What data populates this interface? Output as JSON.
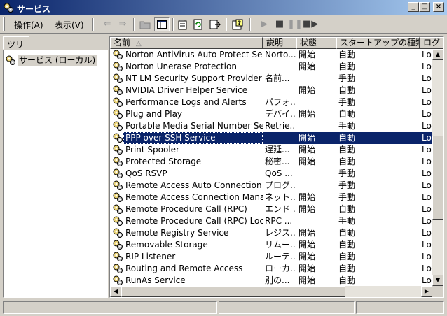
{
  "window": {
    "title": "サービス"
  },
  "menu": {
    "action": "操作(A)",
    "view": "表示(V)"
  },
  "toolbar": {
    "icons": [
      "back-arrow-icon",
      "forward-arrow-icon",
      "folder-up-icon",
      "show-hide-tree-icon",
      "properties-icon",
      "refresh-icon",
      "export-list-icon",
      "help-icon",
      "start-service-icon",
      "stop-service-icon",
      "pause-service-icon",
      "restart-service-icon"
    ]
  },
  "tree": {
    "tab_label": "ツリー",
    "root_label": "サービス (ローカル)"
  },
  "list": {
    "columns": {
      "name": "名前",
      "description": "説明",
      "state": "状態",
      "startup": "スタートアップの種類",
      "logon": "ログ"
    },
    "sort_arrow": "△",
    "rows": [
      {
        "name": "Norton AntiVirus Auto Protect Servi...",
        "description": "Norto...",
        "state": "開始",
        "startup": "自動",
        "logon": "Loc"
      },
      {
        "name": "Norton Unerase Protection",
        "description": "",
        "state": "開始",
        "startup": "自動",
        "logon": "Loc"
      },
      {
        "name": "NT LM Security Support Provider",
        "description": "名前...",
        "state": "",
        "startup": "手動",
        "logon": "Loc"
      },
      {
        "name": "NVIDIA Driver Helper Service",
        "description": "",
        "state": "開始",
        "startup": "自動",
        "logon": "Loc"
      },
      {
        "name": "Performance Logs and Alerts",
        "description": "パフォ...",
        "state": "",
        "startup": "手動",
        "logon": "Loc"
      },
      {
        "name": "Plug and Play",
        "description": "デバイ...",
        "state": "開始",
        "startup": "自動",
        "logon": "Loc"
      },
      {
        "name": "Portable Media Serial Number Servi...",
        "description": "Retrie...",
        "state": "",
        "startup": "手動",
        "logon": "Loc"
      },
      {
        "name": "PPP over SSH Service",
        "description": "",
        "state": "開始",
        "startup": "自動",
        "logon": "Loc",
        "selected": true
      },
      {
        "name": "Print Spooler",
        "description": "遅延...",
        "state": "開始",
        "startup": "自動",
        "logon": "Loc"
      },
      {
        "name": "Protected Storage",
        "description": "秘密...",
        "state": "開始",
        "startup": "自動",
        "logon": "Loc"
      },
      {
        "name": "QoS RSVP",
        "description": "QoS ...",
        "state": "",
        "startup": "手動",
        "logon": "Loc"
      },
      {
        "name": "Remote Access Auto Connection M...",
        "description": "プログ...",
        "state": "",
        "startup": "手動",
        "logon": "Loc"
      },
      {
        "name": "Remote Access Connection Manager",
        "description": "ネット...",
        "state": "開始",
        "startup": "手動",
        "logon": "Loc"
      },
      {
        "name": "Remote Procedure Call (RPC)",
        "description": "エンド ...",
        "state": "開始",
        "startup": "自動",
        "logon": "Loc"
      },
      {
        "name": "Remote Procedure Call (RPC) Locat...",
        "description": "RPC ...",
        "state": "",
        "startup": "手動",
        "logon": "Loc"
      },
      {
        "name": "Remote Registry Service",
        "description": "レジス...",
        "state": "開始",
        "startup": "自動",
        "logon": "Loc"
      },
      {
        "name": "Removable Storage",
        "description": "リムー...",
        "state": "開始",
        "startup": "自動",
        "logon": "Loc"
      },
      {
        "name": "RIP Listener",
        "description": "ルーテ...",
        "state": "開始",
        "startup": "自動",
        "logon": "Loc"
      },
      {
        "name": "Routing and Remote Access",
        "description": "ローカ...",
        "state": "開始",
        "startup": "自動",
        "logon": "Loc"
      },
      {
        "name": "RunAs Service",
        "description": "別の...",
        "state": "開始",
        "startup": "自動",
        "logon": "Loc"
      }
    ]
  },
  "colors": {
    "titlebar_start": "#0a246a",
    "titlebar_end": "#a6caf0",
    "selection": "#0a246a",
    "chrome": "#d4d0c8"
  }
}
